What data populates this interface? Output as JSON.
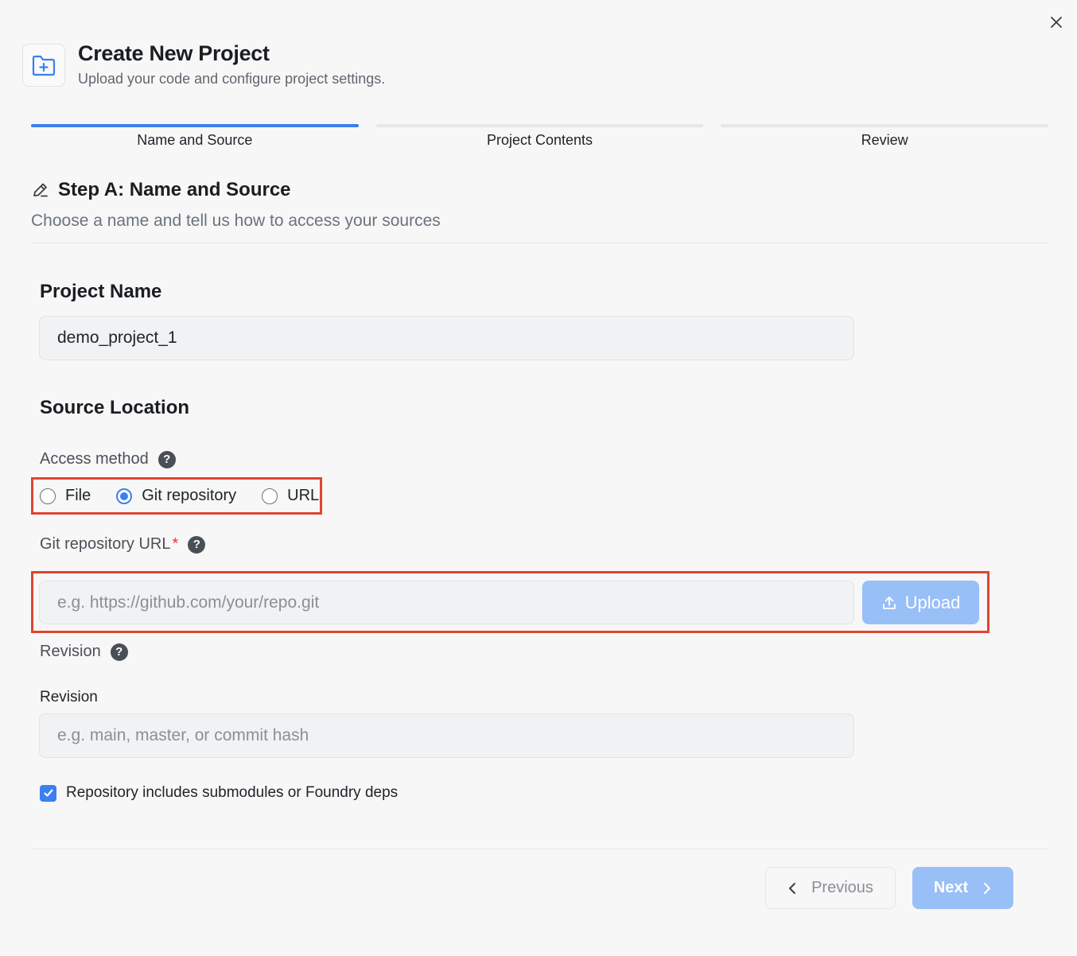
{
  "header": {
    "title": "Create New Project",
    "subtitle": "Upload your code and configure project settings.",
    "icon": "folder-plus-icon"
  },
  "stepper": {
    "steps": [
      {
        "label": "Name and Source",
        "active": true
      },
      {
        "label": "Project Contents",
        "active": false
      },
      {
        "label": "Review",
        "active": false
      }
    ]
  },
  "step": {
    "title": "Step A: Name and Source",
    "description": "Choose a name and tell us how to access your sources",
    "icon": "pencil-icon"
  },
  "project_name": {
    "heading": "Project Name",
    "value": "demo_project_1"
  },
  "source": {
    "heading": "Source Location",
    "access_method_label": "Access method",
    "options": [
      "File",
      "Git repository",
      "URL"
    ],
    "selected": "Git repository",
    "git_url_label": "Git repository URL",
    "required_mark": "*",
    "git_url_placeholder": "e.g. https://github.com/your/repo.git",
    "upload_label": "Upload",
    "revision_label": "Revision",
    "revision_field_label": "Revision",
    "revision_placeholder": "e.g. main, master, or commit hash",
    "submodules_label": "Repository includes submodules or Foundry deps",
    "submodules_checked": true
  },
  "footer": {
    "previous_label": "Previous",
    "next_label": "Next"
  },
  "colors": {
    "accent": "#3b7ff0",
    "accent_disabled": "#99bff7",
    "highlight": "#e0442f",
    "required": "#e5393b"
  }
}
